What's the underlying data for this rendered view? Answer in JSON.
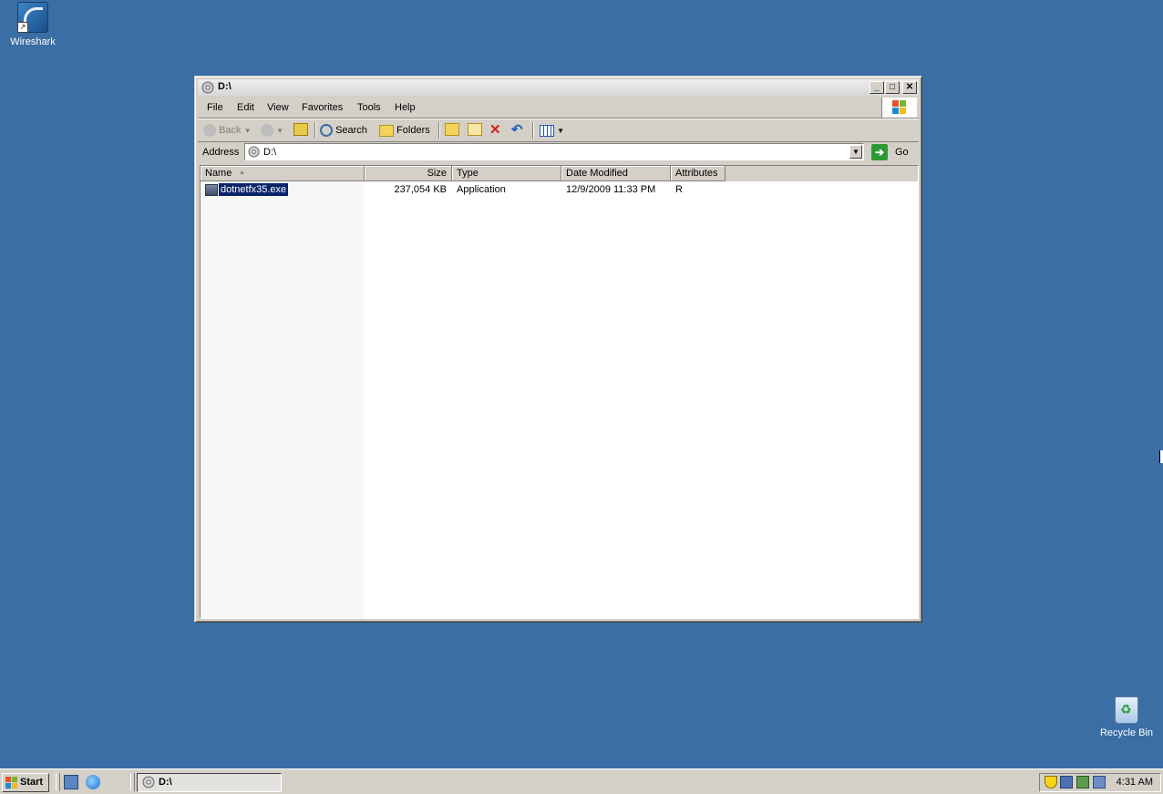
{
  "desktop": {
    "icons": [
      {
        "label": "Wireshark",
        "icon": "wireshark-icon"
      },
      {
        "label": "Recycle Bin",
        "icon": "recycle-bin-icon"
      }
    ],
    "background_color": "#3a6ea5"
  },
  "window": {
    "title": "D:\\",
    "controls": {
      "minimize": "_",
      "maximize": "□",
      "close": "✕"
    },
    "menu": [
      "File",
      "Edit",
      "View",
      "Favorites",
      "Tools",
      "Help"
    ],
    "toolbar": {
      "back": "Back",
      "search": "Search",
      "folders": "Folders"
    },
    "address": {
      "label": "Address",
      "value": "D:\\",
      "go": "Go"
    },
    "list": {
      "columns": [
        "Name",
        "Size",
        "Type",
        "Date Modified",
        "Attributes"
      ],
      "rows": [
        {
          "name": "dotnetfx35.exe",
          "size": "237,054 KB",
          "type": "Application",
          "date": "12/9/2009 11:33 PM",
          "attributes": "R",
          "selected": true
        }
      ]
    }
  },
  "taskbar": {
    "start": "Start",
    "task": "D:\\",
    "clock": "4:31 AM"
  }
}
